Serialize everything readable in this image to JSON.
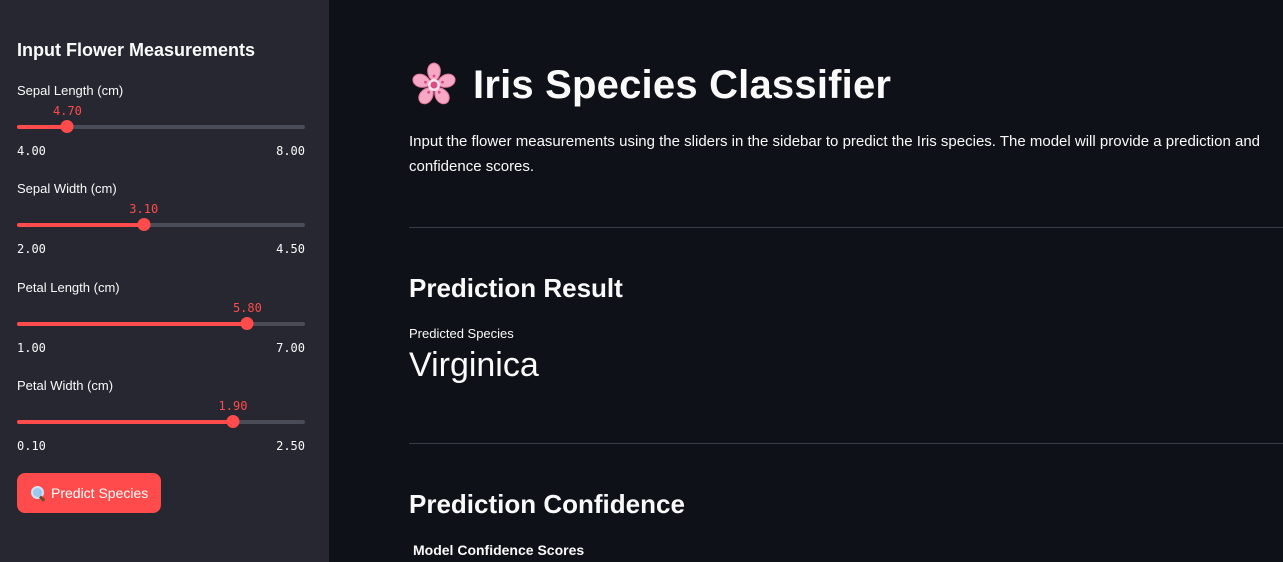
{
  "sidebar": {
    "title": "Input Flower Measurements",
    "sliders": [
      {
        "label": "Sepal Length (cm)",
        "value": "4.70",
        "min": "4.00",
        "max": "8.00",
        "fraction": 0.175
      },
      {
        "label": "Sepal Width (cm)",
        "value": "3.10",
        "min": "2.00",
        "max": "4.50",
        "fraction": 0.44
      },
      {
        "label": "Petal Length (cm)",
        "value": "5.80",
        "min": "1.00",
        "max": "7.00",
        "fraction": 0.8
      },
      {
        "label": "Petal Width (cm)",
        "value": "1.90",
        "min": "0.10",
        "max": "2.50",
        "fraction": 0.75
      }
    ],
    "predict_button": {
      "label": "Predict Species",
      "icon": "search-icon"
    }
  },
  "main": {
    "title": "Iris Species Classifier",
    "title_icon": "cherry-blossom-icon",
    "intro": "Input the flower measurements using the sliders in the sidebar to predict the Iris species. The model will provide a prediction and confidence scores.",
    "prediction_heading": "Prediction Result",
    "metric_label": "Predicted Species",
    "metric_value": "Virginica",
    "confidence_heading": "Prediction Confidence",
    "chart_title": "Model Confidence Scores"
  },
  "colors": {
    "accent": "#ff4b4b",
    "background": "#0e1117",
    "sidebar_background": "#262730",
    "text": "#fafafa"
  }
}
